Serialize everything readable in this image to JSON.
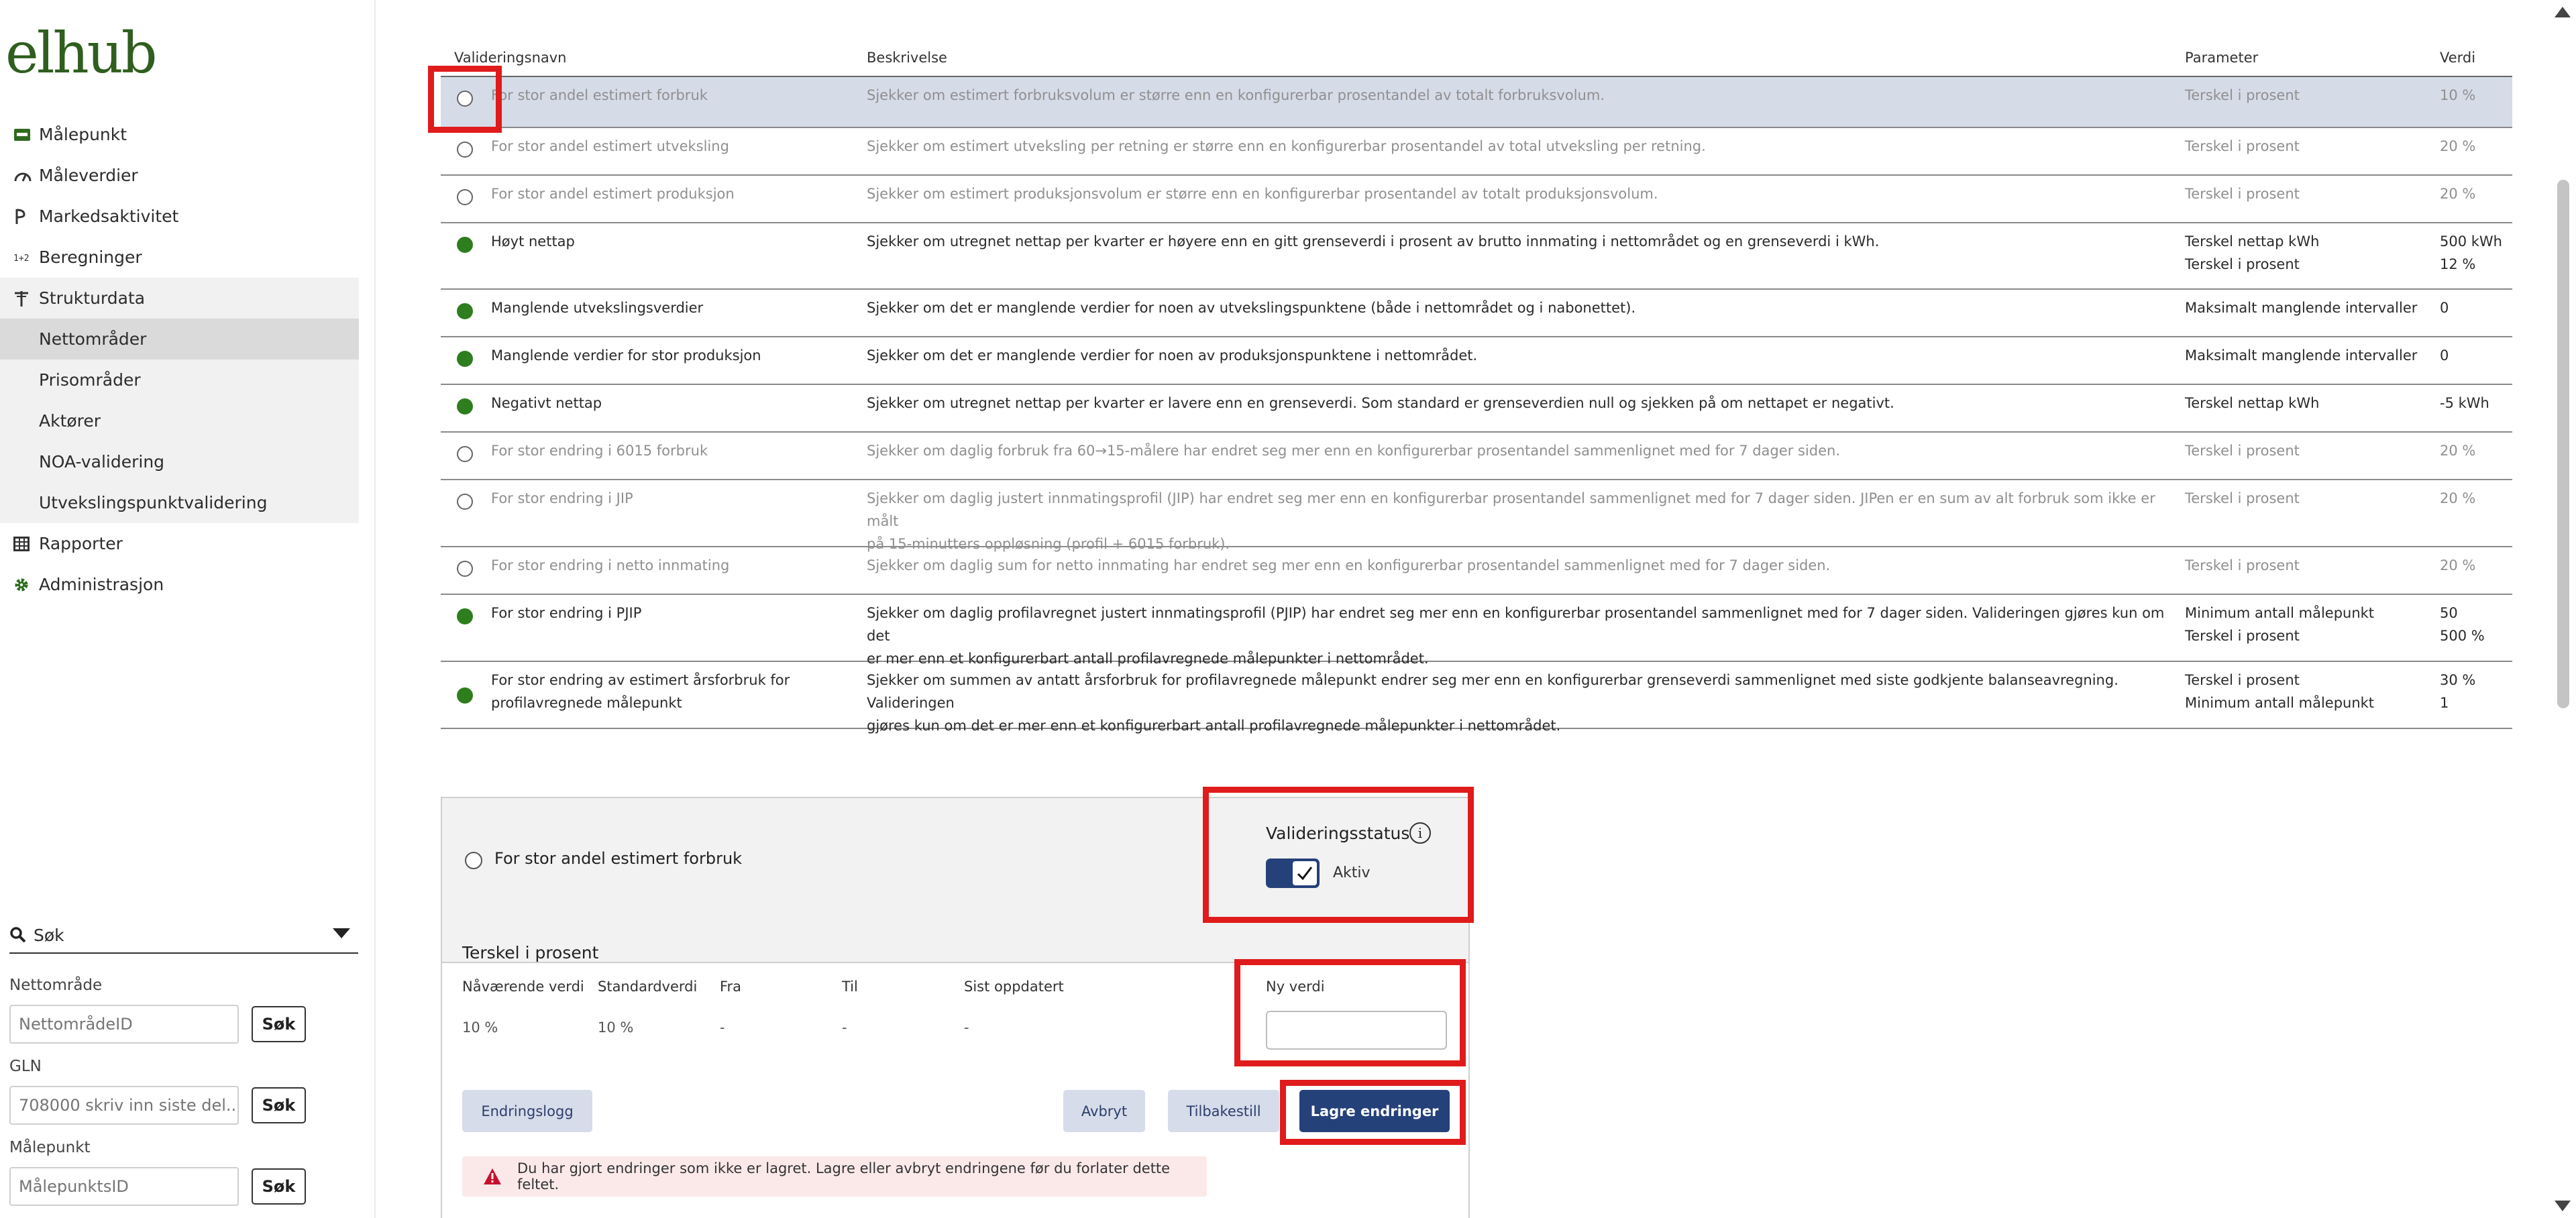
{
  "app": {
    "logo": "elhub"
  },
  "sidebar": {
    "items": [
      {
        "label": "Målepunkt",
        "icon": "meter-card-icon"
      },
      {
        "label": "Måleverdier",
        "icon": "gauge-icon"
      },
      {
        "label": "Markedsaktivitet",
        "icon": "market-activity-icon"
      },
      {
        "label": "Beregninger",
        "icon": "calculation-icon"
      },
      {
        "label": "Strukturdata",
        "icon": "power-pole-icon"
      },
      {
        "label": "Rapporter",
        "icon": "table-icon"
      },
      {
        "label": "Administrasjon",
        "icon": "gear-icon"
      }
    ],
    "subitems": [
      {
        "label": "Nettområder",
        "active": true
      },
      {
        "label": "Prisområder"
      },
      {
        "label": "Aktører"
      },
      {
        "label": "NOA-validering"
      },
      {
        "label": "Utvekslingspunktvalidering"
      }
    ],
    "search": {
      "title": "Søk",
      "button_label": "Søk",
      "fields": [
        {
          "label": "Nettområde",
          "placeholder": "NettområdeID"
        },
        {
          "label": "GLN",
          "placeholder": "708000 skriv inn siste del..."
        },
        {
          "label": "Målepunkt",
          "placeholder": "MålepunktsID"
        }
      ]
    }
  },
  "table": {
    "headers": {
      "name": "Valideringsnavn",
      "description": "Beskrivelse",
      "parameter": "Parameter",
      "value": "Verdi"
    },
    "rows": [
      {
        "name": "For stor andel estimert forbruk",
        "description": "Sjekker om estimert forbruksvolum er større enn en konfigurerbar prosentandel av totalt forbruksvolum.",
        "parameter": "Terskel i prosent",
        "value": "10 %",
        "active": false,
        "selected": true
      },
      {
        "name": "For stor andel estimert utveksling",
        "description": "Sjekker om estimert utveksling per retning er større enn en konfigurerbar prosentandel av total utveksling per retning.",
        "parameter": "Terskel i prosent",
        "value": "20 %",
        "active": false
      },
      {
        "name": "For stor andel estimert produksjon",
        "description": "Sjekker om estimert produksjonsvolum er større enn en konfigurerbar prosentandel av totalt produksjonsvolum.",
        "parameter": "Terskel i prosent",
        "value": "20 %",
        "active": false
      },
      {
        "name": "Høyt nettap",
        "description": "Sjekker om utregnet nettap per kvarter er høyere enn en gitt grenseverdi i prosent av brutto innmating i nettområdet og en grenseverdi i kWh.",
        "parameter": "Terskel nettap kWh\nTerskel i prosent",
        "value": "500 kWh\n12 %",
        "active": true
      },
      {
        "name": "Manglende utvekslingsverdier",
        "description": "Sjekker om det er manglende verdier for noen av utvekslingspunktene (både i nettområdet og i nabonettet).",
        "parameter": "Maksimalt manglende intervaller",
        "value": "0",
        "active": true
      },
      {
        "name": "Manglende verdier for stor produksjon",
        "description": "Sjekker om det er manglende verdier for noen av produksjonspunktene i nettområdet.",
        "parameter": "Maksimalt manglende intervaller",
        "value": "0",
        "active": true
      },
      {
        "name": "Negativt nettap",
        "description": "Sjekker om utregnet nettap per kvarter er lavere enn en grenseverdi. Som standard er grenseverdien null og sjekken på om nettapet er negativt.",
        "parameter": "Terskel nettap kWh",
        "value": "-5 kWh",
        "active": true
      },
      {
        "name": "For stor endring i 6015 forbruk",
        "description": "Sjekker om daglig forbruk fra 60→15-målere har endret seg mer enn en konfigurerbar prosentandel sammenlignet med for 7 dager siden.",
        "parameter": "Terskel i prosent",
        "value": "20 %",
        "active": false
      },
      {
        "name": "For stor endring i JIP",
        "description": "Sjekker om daglig justert innmatingsprofil (JIP) har endret seg mer enn en konfigurerbar prosentandel sammenlignet med for 7 dager siden. JIPen er en sum av alt forbruk som ikke er målt\npå 15-minutters oppløsning (profil + 6015 forbruk).",
        "parameter": "Terskel i prosent",
        "value": "20 %",
        "active": false
      },
      {
        "name": "For stor endring i netto innmating",
        "description": "Sjekker om daglig sum for netto innmating har endret seg mer enn en konfigurerbar prosentandel sammenlignet med for 7 dager siden.",
        "parameter": "Terskel i prosent",
        "value": "20 %",
        "active": false
      },
      {
        "name": "For stor endring i PJIP",
        "description": "Sjekker om daglig profilavregnet justert innmatingsprofil (PJIP) har endret seg mer enn en konfigurerbar prosentandel sammenlignet med for 7 dager siden. Valideringen gjøres kun om det\ner mer enn et konfigurerbart antall profilavregnede målepunkter i nettområdet.",
        "parameter": "Minimum antall målepunkt\nTerskel i prosent",
        "value": "50\n500 %",
        "active": true
      },
      {
        "name": "For stor endring av estimert årsforbruk for\nprofilavregnede målepunkt",
        "description": "Sjekker om summen av antatt årsforbruk for profilavregnede målepunkt endrer seg mer enn en konfigurerbar grenseverdi sammenlignet med siste godkjente balanseavregning. Valideringen\ngjøres kun om det er mer enn et konfigurerbart antall profilavregnede målepunkter i nettområdet.",
        "parameter": "Terskel i prosent\nMinimum antall målepunkt",
        "value": "30 %\n1",
        "active": true
      }
    ]
  },
  "detail": {
    "title": "For stor andel estimert forbruk",
    "status_label": "Valideringsstatus",
    "status_icon": "info-icon",
    "toggle_label": "Aktiv",
    "toggle_on": true,
    "param_title": "Terskel i prosent",
    "columns": {
      "current": "Nåværende verdi",
      "default": "Standardverdi",
      "from": "Fra",
      "to": "Til",
      "updated": "Sist oppdatert",
      "new_value": "Ny verdi"
    },
    "values": {
      "current": "10 %",
      "default": "10 %",
      "from": "-",
      "to": "-",
      "updated": "-"
    },
    "new_value": "",
    "buttons": {
      "log": "Endringslogg",
      "cancel": "Avbryt",
      "reset": "Tilbakestill",
      "save": "Lagre endringer"
    },
    "warning": "Du har gjort endringer som ikke er lagret. Lagre eller avbryt endringene før du forlater dette feltet.",
    "warning_icon": "warning-triangle-icon"
  },
  "colors": {
    "accent": "#25417a",
    "active_dot": "#2e7d1e",
    "highlight": "#e01b1b",
    "selected_row": "#d6dbe8",
    "warning_bg": "#fbe9ea",
    "warning_icon": "#c8102e",
    "logo": "#2f5e1e"
  }
}
